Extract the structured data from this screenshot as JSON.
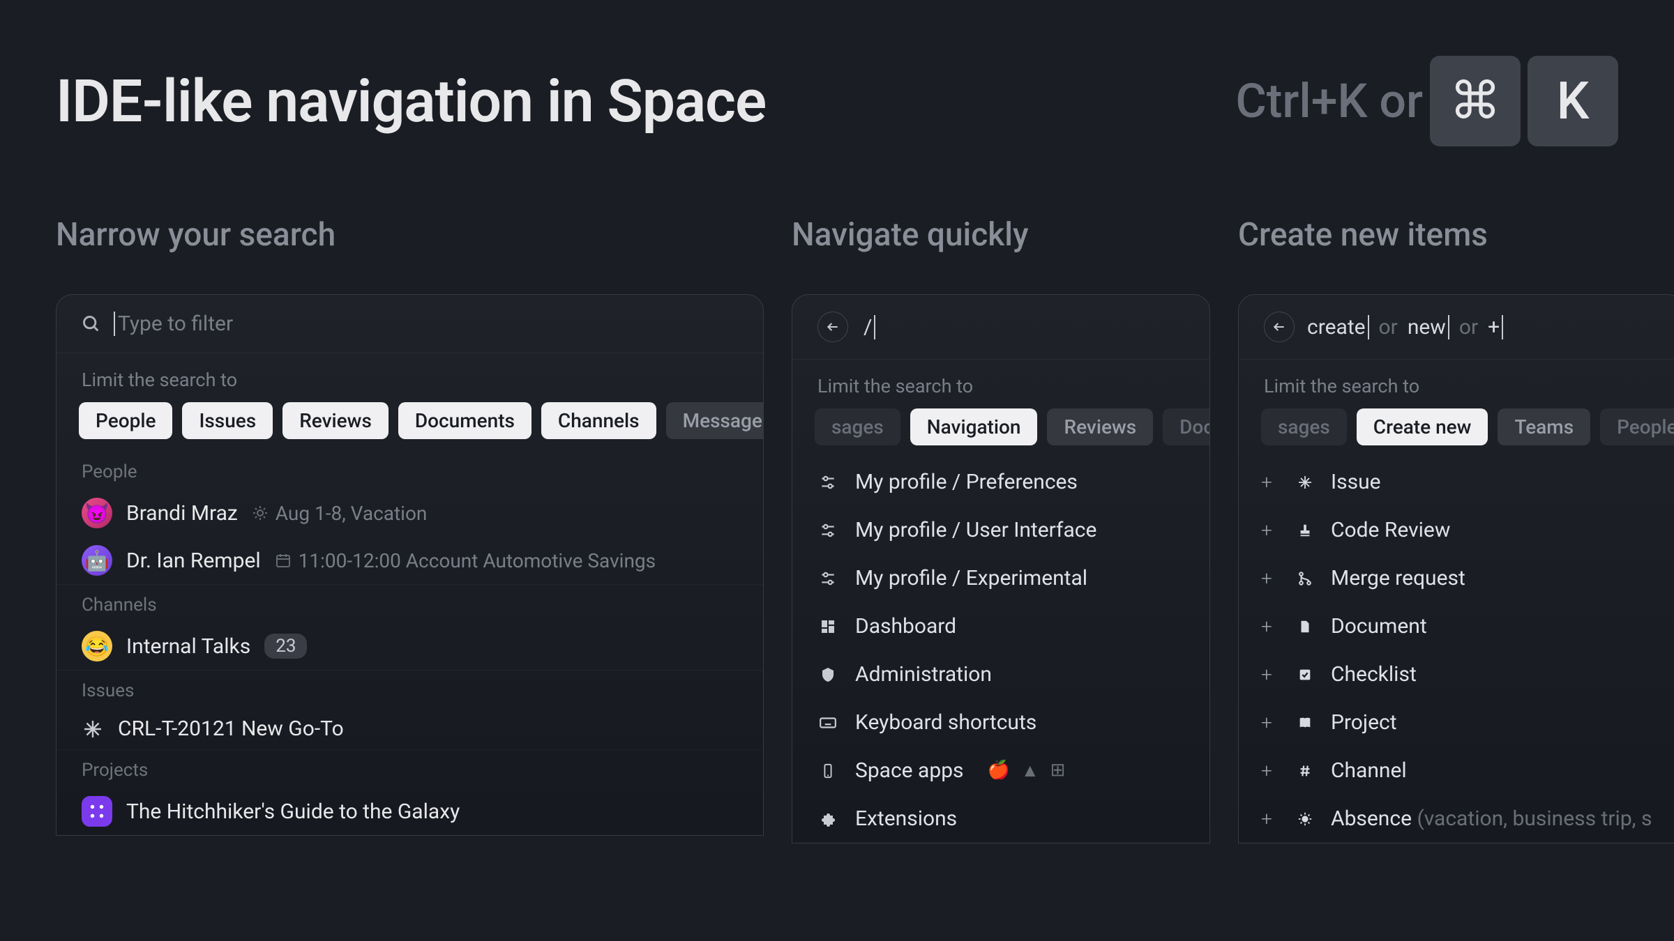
{
  "header": {
    "title": "IDE-like navigation in Space",
    "shortcut_text": "Ctrl+K or",
    "key1": "⌘",
    "key2": "K"
  },
  "columns": {
    "narrow": {
      "heading": "Narrow your search",
      "placeholder": "Type to filter",
      "limit_label": "Limit the search to",
      "chips": [
        "People",
        "Issues",
        "Reviews",
        "Documents",
        "Channels",
        "Messages"
      ],
      "groups": {
        "people": {
          "label": "People",
          "items": [
            {
              "name": "Brandi Mraz",
              "detail": "Aug 1-8, Vacation",
              "icon": "sun"
            },
            {
              "name": "Dr. Ian Rempel",
              "detail": "11:00-12:00 Account Automotive Savings",
              "icon": "calendar"
            }
          ]
        },
        "channels": {
          "label": "Channels",
          "items": [
            {
              "name": "Internal Talks",
              "badge": "23"
            }
          ]
        },
        "issues": {
          "label": "Issues",
          "items": [
            {
              "name": "CRL-T-20121 New Go-To"
            }
          ]
        },
        "projects": {
          "label": "Projects",
          "items": [
            {
              "name": "The Hitchhiker's Guide to the Galaxy"
            }
          ]
        }
      }
    },
    "navigate": {
      "heading": "Navigate quickly",
      "prefix": "/",
      "limit_label": "Limit the search to",
      "chips_pre": "sages",
      "chips": [
        "Navigation",
        "Reviews",
        "Docume"
      ],
      "items": [
        {
          "icon": "sliders",
          "text": "My profile / Preferences"
        },
        {
          "icon": "sliders",
          "text": "My profile / User Interface"
        },
        {
          "icon": "sliders",
          "text": "My profile / Experimental"
        },
        {
          "icon": "dashboard",
          "text": "Dashboard"
        },
        {
          "icon": "shield",
          "text": "Administration"
        },
        {
          "icon": "keyboard",
          "text": "Keyboard shortcuts"
        },
        {
          "icon": "phone",
          "text": "Space apps",
          "platforms": true
        },
        {
          "icon": "puzzle",
          "text": "Extensions"
        }
      ]
    },
    "create": {
      "heading": "Create new items",
      "terms": [
        "create",
        "new",
        "+"
      ],
      "or": "or",
      "limit_label": "Limit the search to",
      "chips_pre": "sages",
      "chips": [
        "Create new",
        "Teams",
        "People"
      ],
      "items": [
        {
          "icon": "sparkle",
          "text": "Issue"
        },
        {
          "icon": "stamp",
          "text": "Code Review"
        },
        {
          "icon": "merge",
          "text": "Merge request"
        },
        {
          "icon": "doc",
          "text": "Document"
        },
        {
          "icon": "check",
          "text": "Checklist"
        },
        {
          "icon": "book",
          "text": "Project"
        },
        {
          "icon": "hash",
          "text": "Channel"
        },
        {
          "icon": "sun",
          "text": "Absence",
          "detail": "(vacation, business trip, s"
        }
      ]
    }
  }
}
